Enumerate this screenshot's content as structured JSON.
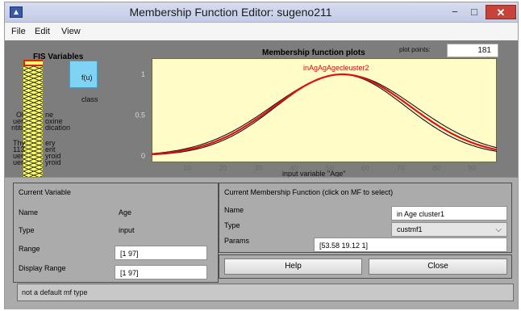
{
  "window": {
    "title": "Membership Function Editor: sugeno211",
    "minimize": "−",
    "maximize": "□",
    "close": "✕"
  },
  "menu": [
    "File",
    "Edit",
    "View"
  ],
  "fis": {
    "title": "FIS Variables",
    "output_label": "f(u)",
    "output_name": "class",
    "truncated_names": [
      "Ol",
      "uer",
      "ntiti",
      "ne",
      "oxine",
      "dication",
      "Thy",
      "113",
      "uer",
      "uer",
      "ery",
      "ent",
      "yroid",
      "yroid"
    ]
  },
  "plot": {
    "title": "Membership function plots",
    "plot_points_label": "plot points:",
    "plot_points_value": "181",
    "mf_label": "inAgAgAgecleuster2",
    "x_axis_label": "input variable \"Age\""
  },
  "chart_data": {
    "type": "line",
    "xlabel": "input variable \"Age\"",
    "x_ticks": [
      10,
      20,
      30,
      40,
      50,
      60,
      70,
      80,
      90
    ],
    "y_ticks": [
      0,
      0.5,
      1
    ],
    "xlim": [
      0,
      97
    ],
    "ylim": [
      0,
      1
    ],
    "series": [
      {
        "name": "in Age cluster1",
        "color": "#e01010",
        "type": "gaussian",
        "sigma": 19.12,
        "center": 53.58
      },
      {
        "color": "#111111",
        "type": "gaussian",
        "sigma": 18.2,
        "center": 53.2
      },
      {
        "color": "#111111",
        "type": "gaussian",
        "sigma": 20.1,
        "center": 53.9
      }
    ]
  },
  "current_variable": {
    "title": "Current Variable",
    "name_label": "Name",
    "name_value": "Age",
    "type_label": "Type",
    "type_value": "input",
    "range_label": "Range",
    "range_value": "[1 97]",
    "display_range_label": "Display Range",
    "display_range_value": "[1 97]"
  },
  "current_mf": {
    "title": "Current Membership Function (click on MF to select)",
    "name_label": "Name",
    "name_value": "in Age cluster1",
    "type_label": "Type",
    "type_value": "custmf1",
    "params_label": "Params",
    "params_value": "[53.58 19.12 1]"
  },
  "buttons": {
    "help": "Help",
    "close": "Close"
  },
  "status": "not a default mf type"
}
